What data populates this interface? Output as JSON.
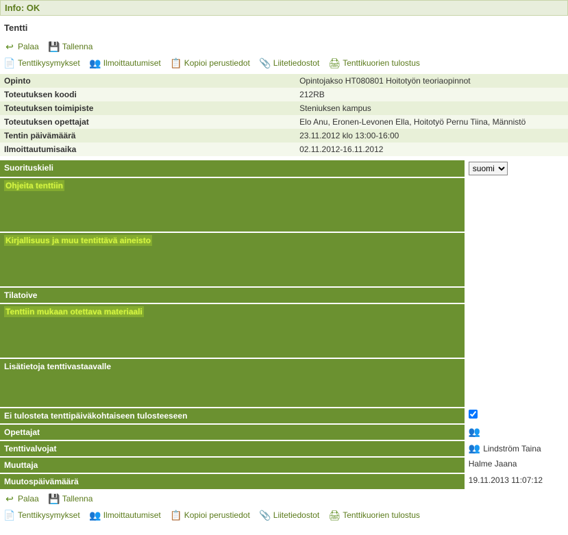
{
  "header": {
    "info_label": "Info: OK",
    "title": "Tentti"
  },
  "actions": {
    "back": "Palaa",
    "save": "Tallenna",
    "questions": "Tenttikysymykset",
    "registrations": "Ilmoittautumiset",
    "copy_basic": "Kopioi perustiedot",
    "attachments": "Liitetiedostot",
    "print_envelopes": "Tenttikuorien tulostus"
  },
  "info": {
    "rows": [
      {
        "label": "Opinto",
        "value": "Opintojakso HT080801 Hoitotyön teoriaopinnot"
      },
      {
        "label": "Toteutuksen koodi",
        "value": "212RB"
      },
      {
        "label": "Toteutuksen toimipiste",
        "value": "Steniuksen kampus"
      },
      {
        "label": "Toteutuksen opettajat",
        "value": "Elo Anu, Eronen-Levonen Ella, Hoitotyö Pernu Tiina, Männistö"
      },
      {
        "label": "Tentin päivämäärä",
        "value": "23.11.2012 klo 13:00-16:00"
      },
      {
        "label": "Ilmoittautumisaika",
        "value": "02.11.2012-16.11.2012"
      }
    ]
  },
  "form": {
    "language_label": "Suorituskieli",
    "language_value": "suomi",
    "instructions_label": "Ohjeita tenttiin",
    "literature_label": "Kirjallisuus ja muu tentittävä aineisto",
    "room_wish_label": "Tilatoive",
    "materials_label": "Tenttiin mukaan otettava materiaali",
    "extra_info_label": "Lisätietoja tenttivastaavalle",
    "no_print_label": "Ei tulosteta tenttipäiväkohtaiseen tulosteeseen",
    "teachers_label": "Opettajat",
    "supervisors_label": "Tenttivalvojat",
    "supervisors_value": "Lindström Taina",
    "modifier_label": "Muuttaja",
    "modifier_value": "Halme Jaana",
    "modified_date_label": "Muutospäivämäärä",
    "modified_date_value": "19.11.2013 11:07:12"
  }
}
